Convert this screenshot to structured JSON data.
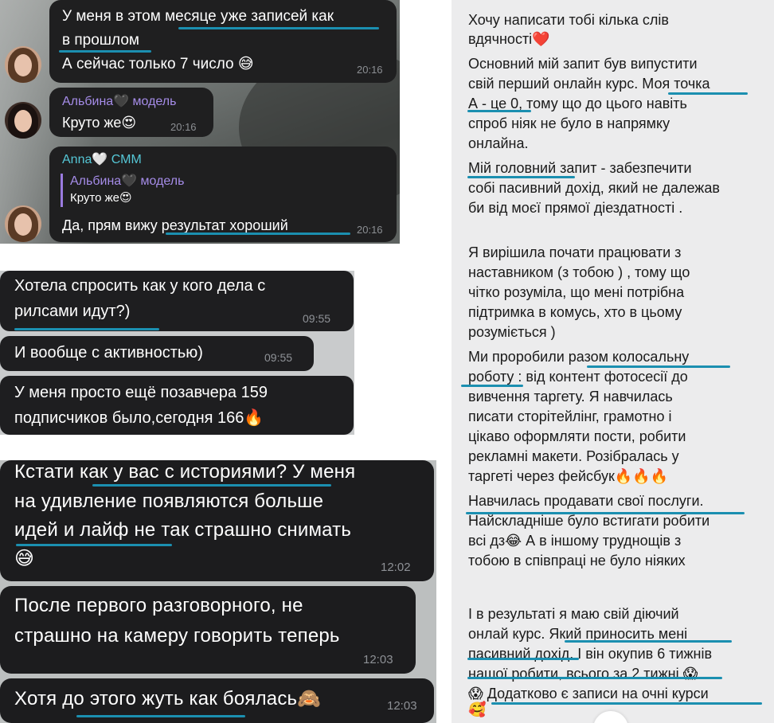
{
  "panel1": {
    "msg1": {
      "line1": "У меня в этом месяце уже записей как",
      "line2": "в прошлом",
      "line3": "А сейчас только 7 число 😅",
      "time": "20:16"
    },
    "msg2": {
      "sender": "Альбина🖤 модель",
      "text": "Круто же😍",
      "time": "20:16"
    },
    "msg3": {
      "sender": "Anna🤍 СММ",
      "quote_sender": "Альбина🖤 модель",
      "quote_text": "Круто же😍",
      "text": "Да, прям вижу результат хороший",
      "time": "20:16"
    }
  },
  "panel2": {
    "msg1": {
      "line1": "Хотела спросить как у кого дела с",
      "line2": "рилсами идут?)",
      "time": "09:55"
    },
    "msg2": {
      "text": "И вообще с активностью)",
      "time": "09:55"
    },
    "msg3": {
      "line1": "У меня просто ещё позавчера 159",
      "line2": "подписчиков было,сегодня 166🔥"
    }
  },
  "panel3": {
    "msg1": {
      "line1": "Кстати как у вас с историями? У меня",
      "line2": "на удивление появляются больше",
      "line3": "идей и лайф не так страшно снимать",
      "line4": "😅",
      "time": "12:02"
    },
    "msg2": {
      "line1": "После первого разговорного, не",
      "line2": "страшно на камеру говорить теперь",
      "time": "12:03"
    },
    "msg3": {
      "text": "Хотя до этого жуть как боялась🙈",
      "time": "12:03"
    }
  },
  "panel4": {
    "lines": [
      "Хочу написати тобі кілька слів",
      "вдячності❤️",
      "Основний мій запит був випустити",
      "свій перший онлайн курс. Моя точка",
      "А - це 0, тому що до цього навіть",
      "спроб ніяк не було в напрямку",
      "онлайна.",
      "Мій головний запит - забезпечити",
      "собі пасивний дохід, який не далежав",
      "би від моєї прямої діездатності .",
      "",
      "Я вирішила почати працювати з",
      "наставником (з тобою ) , тому що",
      "чітко розуміла, що мені потрібна",
      "підтримка в комусь, хто в цьому",
      "розуміється )",
      "Ми проробили разом колосальну",
      "роботу : від контент фотосесії до",
      "вивчення таргету. Я навчилась",
      "писати сторітейлінг, грамотно і",
      "цікаво оформляти пости, робити",
      "рекламні макети. Розібралась у",
      "таргеті через фейсбук🔥🔥🔥",
      "Навчилась продавати свої послуги.",
      "Найскладніше було встигати робити",
      "всі дз😂 А в іншому труднощів з",
      "тобою в співпраці не було ніяких",
      "",
      "І в результаті я маю свій діючий",
      "онлай курс. Який приносить мені",
      "пасивний дохід. І він окупив 6 тижнів",
      "нашої робити, всього за 2 тижні 😱",
      "😱 Додатково є записи на очні курси",
      "🥰"
    ]
  },
  "colors": {
    "underline": "#1b8fb0",
    "bubble_dark": "#1f1f20",
    "sender_purple": "#a58ce8",
    "sender_teal": "#55c7d6",
    "timestamp": "#8c8f93"
  }
}
